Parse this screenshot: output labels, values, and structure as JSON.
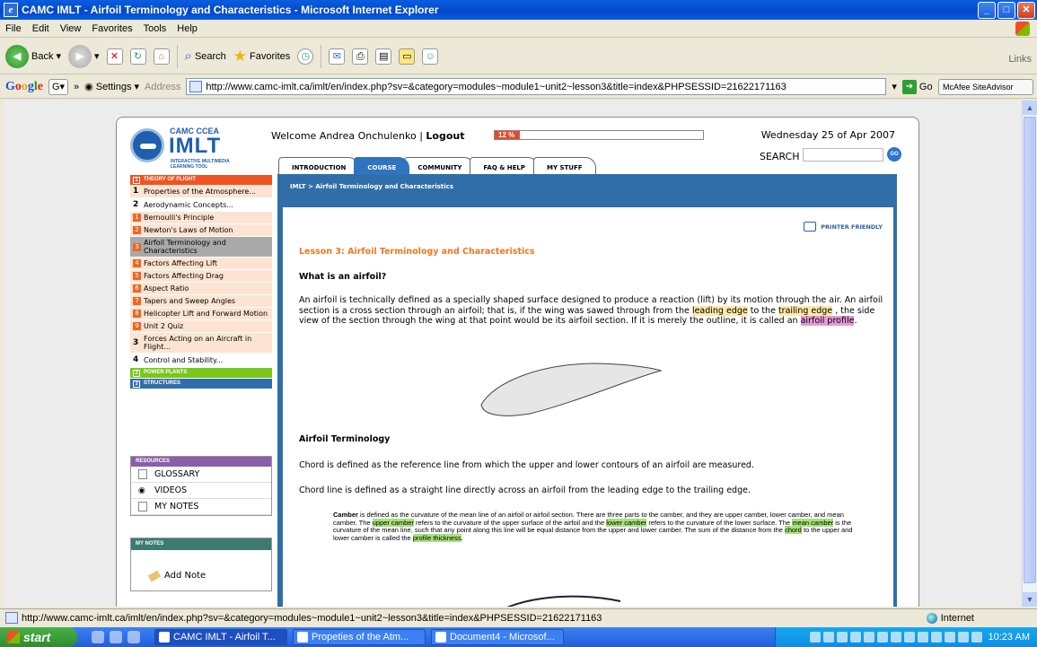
{
  "window": {
    "title": "CAMC IMLT - Airfoil Terminology and Characteristics - Microsoft Internet Explorer",
    "menu": [
      "File",
      "Edit",
      "View",
      "Favorites",
      "Tools",
      "Help"
    ]
  },
  "toolbar": {
    "back": "Back",
    "search": "Search",
    "favorites": "Favorites",
    "links": "Links"
  },
  "addressbar": {
    "google": "Google",
    "settings": "Settings",
    "address_label": "Address",
    "url": "http://www.camc-imlt.ca/imlt/en/index.php?sv=&category=modules~module1~unit2~lesson3&title=index&PHPSESSID=21622171163",
    "go": "Go",
    "mcafee": "McAfee SiteAdvisor"
  },
  "page": {
    "logo": {
      "line1": "CAMC CCEA",
      "line2": "IMLT",
      "line3": "INTERACTIVE MULTIMEDIA LEARNING TOOL"
    },
    "welcome_prefix": "Welcome Andrea Onchulenko |",
    "logout": "Logout",
    "progress": {
      "label": "12 %",
      "value": 0.12
    },
    "date": "Wednesday 25 of Apr 2007",
    "search_label": "SEARCH",
    "search_go": "GO",
    "tabs": [
      "INTRODUCTION",
      "COURSE",
      "COMMUNITY",
      "FAQ & HELP",
      "MY STUFF"
    ],
    "active_tab": "COURSE",
    "breadcrumb": "IMLT > Airfoil Terminology and Characteristics",
    "printer_friendly": "PRINTER FRIENDLY",
    "lesson_title": "Lesson 3: Airfoil Terminology and Characteristics",
    "h_what": "What is an airfoil?",
    "p1": {
      "a": "An airfoil is technically defined as a specially shaped surface designed to produce a reaction (lift) by its motion through the air. An airfoil section is a cross section through an airfoil; that is, if the wing was sawed through from the",
      "hl1": "leading edge",
      "b": "to the",
      "hl2": "trailing edge",
      "c": ", the side view of the section through the wing at that point would be its airfoil section. If it is merely the outline, it is called an",
      "hl3": "airfoil profile",
      "d": "."
    },
    "h_terms": "Airfoil Terminology",
    "chord_def": "Chord is defined as the reference line from which the upper and lower contours of an airfoil are measured.",
    "chordline_def": "Chord line is defined as a straight line directly across an airfoil from the leading edge to the trailing edge.",
    "camber": {
      "term": "Camber",
      "a": "is defined as the curvature of the mean line of an airfoil or airfoil section. There are three parts to the camber, and they are upper camber, lower camber, and mean camber. The",
      "hl1": "upper camber",
      "b": "refers to the curvature of the upper surface of the airfoil and the",
      "hl2": "lower camber",
      "c": "refers to the curvature of the lower surface. The",
      "hl3": "mean camber",
      "d": "is the curvature of the mean line, such that any point along this line will be equal distance from the upper and lower camber. The sum of the distance from the",
      "hl4": "chord",
      "e": "to the upper and lower camber is called the",
      "hl5": "profile thickness",
      "f": "."
    },
    "nav": {
      "theory": {
        "num": "1",
        "label": "THEORY OF FLIGHT"
      },
      "items": [
        {
          "n": "1",
          "label": "Properties of the Atmosphere...",
          "kind": "unit"
        },
        {
          "n": "2",
          "label": "Aerodynamic Concepts...",
          "kind": "unit-plain"
        },
        {
          "n": "1",
          "label": "Bernoulli's Principle",
          "kind": "lesson"
        },
        {
          "n": "2",
          "label": "Newton's Laws of Motion",
          "kind": "lesson"
        },
        {
          "n": "3",
          "label": "Airfoil Terminology and Characteristics",
          "kind": "selected"
        },
        {
          "n": "4",
          "label": "Factors Affecting Lift",
          "kind": "lesson"
        },
        {
          "n": "5",
          "label": "Factors Affecting Drag",
          "kind": "lesson"
        },
        {
          "n": "6",
          "label": "Aspect Ratio",
          "kind": "lesson"
        },
        {
          "n": "7",
          "label": "Tapers and Sweep Angles",
          "kind": "lesson"
        },
        {
          "n": "8",
          "label": "Helicopter Lift and Forward Motion",
          "kind": "lesson"
        },
        {
          "n": "9",
          "label": "Unit 2 Quiz",
          "kind": "lesson"
        },
        {
          "n": "3",
          "label": "Forces Acting on an Aircraft in Flight...",
          "kind": "unit"
        },
        {
          "n": "4",
          "label": "Control and Stability...",
          "kind": "unit-plain"
        }
      ],
      "power": {
        "num": "2",
        "label": "POWER PLANTS"
      },
      "struct": {
        "num": "3",
        "label": "STRUCTURES"
      }
    },
    "resources": {
      "title": "RESOURCES",
      "items": [
        "GLOSSARY",
        "VIDEOS",
        "MY NOTES"
      ]
    },
    "mynotes": {
      "title": "MY NOTES",
      "add": "Add Note"
    }
  },
  "status": {
    "url": "http://www.camc-imlt.ca/imlt/en/index.php?sv=&category=modules~module1~unit2~lesson3&title=index&PHPSESSID=21622171163",
    "zone": "Internet"
  },
  "taskbar": {
    "start": "start",
    "tasks": [
      "CAMC IMLT - Airfoil T...",
      "Propeties of the Atm...",
      "Document4 - Microsof..."
    ],
    "clock": "10:23 AM"
  }
}
